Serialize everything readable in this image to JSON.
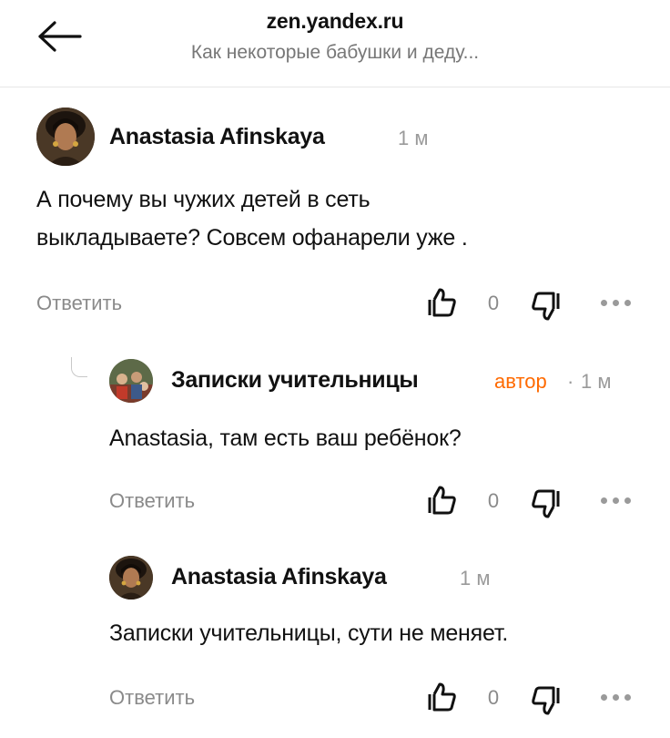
{
  "header": {
    "domain": "zen.yandex.ru",
    "title": "Как некоторые бабушки и деду..."
  },
  "icons": {
    "back": "arrow-left-icon",
    "like": "thumbs-up-icon",
    "dislike": "thumbs-down-icon",
    "more": "more-dots-icon"
  },
  "colors": {
    "author_badge": "#ff6a00",
    "meta": "#9a9a9a"
  },
  "comments": [
    {
      "author": "Anastasia Afinskaya",
      "time": "1 м",
      "text_lines": [
        "А почему вы чужих детей в сеть",
        "выкладываете? Совсем офанарели уже ."
      ],
      "reply_label": "Ответить",
      "likes": "0"
    },
    {
      "author": "Записки учительницы",
      "badge": "автор",
      "separator": "·",
      "time": "1 м",
      "text": "Anastasia, там есть ваш ребёнок?",
      "reply_label": "Ответить",
      "likes": "0"
    },
    {
      "author": "Anastasia Afinskaya",
      "time": "1 м",
      "text": "Записки учительницы, сути не меняет.",
      "reply_label": "Ответить",
      "likes": "0"
    }
  ]
}
